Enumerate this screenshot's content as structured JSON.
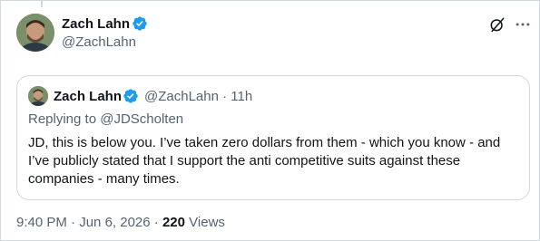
{
  "author": {
    "name": "Zach Lahn",
    "handle": "@ZachLahn",
    "verified": true
  },
  "header_icons": {
    "grok": "grok-icon",
    "more": "more-icon"
  },
  "quoted": {
    "name": "Zach Lahn",
    "handle": "@ZachLahn",
    "separator": " · ",
    "age": "11h",
    "replying_prefix": "Replying to ",
    "replying_handle": "@JDScholten",
    "text": "JD, this is below you. I’ve taken zero dollars from them - which you know - and I’ve publicly stated that I support the anti competitive suits against these companies - many times."
  },
  "footer": {
    "time": "9:40 PM",
    "separator1": " · ",
    "date": "Jun 6, 2026",
    "separator2": " · ",
    "views": "220",
    "views_label": " Views"
  },
  "colors": {
    "verified": "#1d9bf0",
    "secondary_text": "#536471",
    "border": "#cfd9de"
  }
}
